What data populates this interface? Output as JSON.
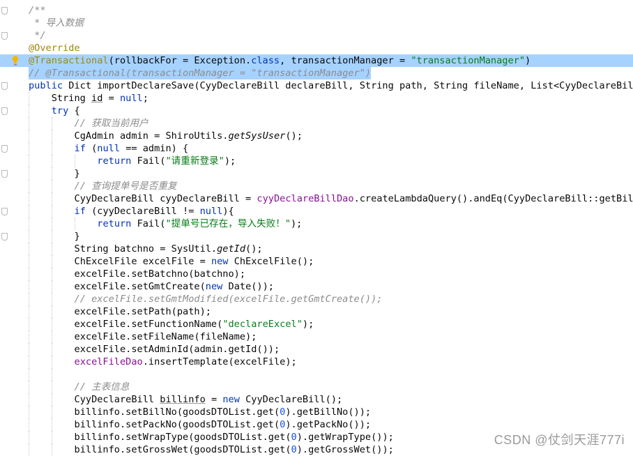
{
  "editor": {
    "lines": [
      {
        "indent": 0,
        "fold": true,
        "tokens": [
          {
            "c": "cmt",
            "t": "/**"
          }
        ]
      },
      {
        "indent": 0,
        "fold": false,
        "tokens": [
          {
            "c": "cmt",
            "t": " * 导入数据"
          }
        ]
      },
      {
        "indent": 0,
        "fold": true,
        "tokens": [
          {
            "c": "cmt",
            "t": " */"
          }
        ]
      },
      {
        "indent": 0,
        "fold": false,
        "tokens": [
          {
            "c": "ann",
            "t": "@Override"
          }
        ]
      },
      {
        "indent": 0,
        "fold": false,
        "selected": true,
        "bulb": true,
        "tokens": [
          {
            "c": "ann",
            "t": "@Transactional"
          },
          {
            "c": "",
            "t": "(rollbackFor = Exception."
          },
          {
            "c": "kw",
            "t": "class"
          },
          {
            "c": "",
            "t": ", transactionManager = "
          },
          {
            "c": "str",
            "t": "\"transactionManager\""
          },
          {
            "c": "",
            "t": ")"
          }
        ]
      },
      {
        "indent": 0,
        "fold": false,
        "selected_tail": true,
        "tokens": [
          {
            "c": "cmt",
            "t": "// @Transactional(transactionManager = \"transactionManager\")"
          }
        ]
      },
      {
        "indent": 0,
        "fold": true,
        "tokens": [
          {
            "c": "kw",
            "t": "public "
          },
          {
            "c": "",
            "t": "Dict "
          },
          {
            "c": "fn",
            "t": "importDeclareSave"
          },
          {
            "c": "",
            "t": "(CyyDeclareBill declareBill, String path, String fileName, List<CyyDeclareBillGo"
          }
        ]
      },
      {
        "indent": 1,
        "fold": false,
        "tokens": [
          {
            "c": "",
            "t": "String "
          },
          {
            "c": "ul",
            "t": "id"
          },
          {
            "c": "",
            "t": " = "
          },
          {
            "c": "kw",
            "t": "null"
          },
          {
            "c": "",
            "t": ";"
          }
        ]
      },
      {
        "indent": 1,
        "fold": true,
        "tokens": [
          {
            "c": "kw",
            "t": "try "
          },
          {
            "c": "",
            "t": "{"
          }
        ]
      },
      {
        "indent": 2,
        "fold": false,
        "tokens": [
          {
            "c": "cmt",
            "t": "// 获取当前用户"
          }
        ]
      },
      {
        "indent": 2,
        "fold": false,
        "tokens": [
          {
            "c": "",
            "t": "CgAdmin admin = ShiroUtils."
          },
          {
            "c": "st",
            "t": "getSysUser"
          },
          {
            "c": "",
            "t": "();"
          }
        ]
      },
      {
        "indent": 2,
        "fold": true,
        "tokens": [
          {
            "c": "kw",
            "t": "if "
          },
          {
            "c": "",
            "t": "("
          },
          {
            "c": "kw",
            "t": "null"
          },
          {
            "c": "",
            "t": " == admin) {"
          }
        ]
      },
      {
        "indent": 3,
        "fold": false,
        "tokens": [
          {
            "c": "kw",
            "t": "return "
          },
          {
            "c": "",
            "t": "Fail("
          },
          {
            "c": "str",
            "t": "\"请重新登录\""
          },
          {
            "c": "",
            "t": ");"
          }
        ]
      },
      {
        "indent": 2,
        "fold": true,
        "tokens": [
          {
            "c": "",
            "t": "}"
          }
        ]
      },
      {
        "indent": 2,
        "fold": false,
        "tokens": [
          {
            "c": "cmt",
            "t": "// 查询提单号是否重复"
          }
        ]
      },
      {
        "indent": 2,
        "fold": false,
        "tokens": [
          {
            "c": "",
            "t": "CyyDeclareBill cyyDeclareBill = "
          },
          {
            "c": "fld",
            "t": "cyyDeclareBillDao"
          },
          {
            "c": "",
            "t": ".createLambdaQuery().andEq(CyyDeclareBill::getBillNo"
          }
        ]
      },
      {
        "indent": 2,
        "fold": true,
        "tokens": [
          {
            "c": "kw",
            "t": "if "
          },
          {
            "c": "",
            "t": "(cyyDeclareBill != "
          },
          {
            "c": "kw",
            "t": "null"
          },
          {
            "c": "",
            "t": "){"
          }
        ]
      },
      {
        "indent": 3,
        "fold": false,
        "tokens": [
          {
            "c": "kw",
            "t": "return "
          },
          {
            "c": "",
            "t": "Fail("
          },
          {
            "c": "str",
            "t": "\"提单号已存在，导入失败！\""
          },
          {
            "c": "",
            "t": ");"
          }
        ]
      },
      {
        "indent": 2,
        "fold": true,
        "tokens": [
          {
            "c": "",
            "t": "}"
          }
        ]
      },
      {
        "indent": 2,
        "fold": false,
        "tokens": [
          {
            "c": "",
            "t": "String batchno = SysUtil."
          },
          {
            "c": "st",
            "t": "getId"
          },
          {
            "c": "",
            "t": "();"
          }
        ]
      },
      {
        "indent": 2,
        "fold": false,
        "tokens": [
          {
            "c": "",
            "t": "ChExcelFile excelFile = "
          },
          {
            "c": "kw",
            "t": "new "
          },
          {
            "c": "",
            "t": "ChExcelFile();"
          }
        ]
      },
      {
        "indent": 2,
        "fold": false,
        "tokens": [
          {
            "c": "",
            "t": "excelFile.setBatchno(batchno);"
          }
        ]
      },
      {
        "indent": 2,
        "fold": false,
        "tokens": [
          {
            "c": "",
            "t": "excelFile.setGmtCreate("
          },
          {
            "c": "kw",
            "t": "new "
          },
          {
            "c": "",
            "t": "Date());"
          }
        ]
      },
      {
        "indent": 2,
        "fold": false,
        "tokens": [
          {
            "c": "cmt",
            "t": "// excelFile.setGmtModified(excelFile.getGmtCreate());"
          }
        ]
      },
      {
        "indent": 2,
        "fold": false,
        "tokens": [
          {
            "c": "",
            "t": "excelFile.setPath(path);"
          }
        ]
      },
      {
        "indent": 2,
        "fold": false,
        "tokens": [
          {
            "c": "",
            "t": "excelFile.setFunctionName("
          },
          {
            "c": "str",
            "t": "\"declareExcel\""
          },
          {
            "c": "",
            "t": ");"
          }
        ]
      },
      {
        "indent": 2,
        "fold": false,
        "tokens": [
          {
            "c": "",
            "t": "excelFile.setFileName(fileName);"
          }
        ]
      },
      {
        "indent": 2,
        "fold": false,
        "tokens": [
          {
            "c": "",
            "t": "excelFile.setAdminId(admin.getId());"
          }
        ]
      },
      {
        "indent": 2,
        "fold": false,
        "tokens": [
          {
            "c": "fld",
            "t": "excelFileDao"
          },
          {
            "c": "",
            "t": ".insertTemplate(excelFile);"
          }
        ]
      },
      {
        "indent": 2,
        "fold": false,
        "tokens": []
      },
      {
        "indent": 2,
        "fold": false,
        "tokens": [
          {
            "c": "cmt",
            "t": "// 主表信息"
          }
        ]
      },
      {
        "indent": 2,
        "fold": false,
        "tokens": [
          {
            "c": "",
            "t": "CyyDeclareBill "
          },
          {
            "c": "ul",
            "t": "billinfo"
          },
          {
            "c": "",
            "t": " = "
          },
          {
            "c": "kw",
            "t": "new "
          },
          {
            "c": "",
            "t": "CyyDeclareBill();"
          }
        ]
      },
      {
        "indent": 2,
        "fold": false,
        "tokens": [
          {
            "c": "",
            "t": "billinfo.setBillNo(goodsDTOList.get("
          },
          {
            "c": "num",
            "t": "0"
          },
          {
            "c": "",
            "t": ").getBillNo());"
          }
        ]
      },
      {
        "indent": 2,
        "fold": false,
        "tokens": [
          {
            "c": "",
            "t": "billinfo.setPackNo(goodsDTOList.get("
          },
          {
            "c": "num",
            "t": "0"
          },
          {
            "c": "",
            "t": ").getPackNo());"
          }
        ]
      },
      {
        "indent": 2,
        "fold": false,
        "tokens": [
          {
            "c": "",
            "t": "billinfo.setWrapType(goodsDTOList.get("
          },
          {
            "c": "num",
            "t": "0"
          },
          {
            "c": "",
            "t": ").getWrapType());"
          }
        ]
      },
      {
        "indent": 2,
        "fold": false,
        "tokens": [
          {
            "c": "",
            "t": "billinfo.setGrossWet(goodsDTOList.get("
          },
          {
            "c": "num",
            "t": "0"
          },
          {
            "c": "",
            "t": ").getGrossWet());"
          }
        ]
      }
    ]
  },
  "watermark": "CSDN @仗剑天涯777i",
  "colors": {
    "keyword": "#0033b3",
    "annotation": "#9e880d",
    "string": "#067d17",
    "number": "#1750eb",
    "comment": "#8c8c8c",
    "field": "#871094",
    "selection": "#a6d2ff"
  },
  "icons": {
    "fold_marker": "fold-marker-icon",
    "intention_bulb": "lightbulb-icon"
  }
}
